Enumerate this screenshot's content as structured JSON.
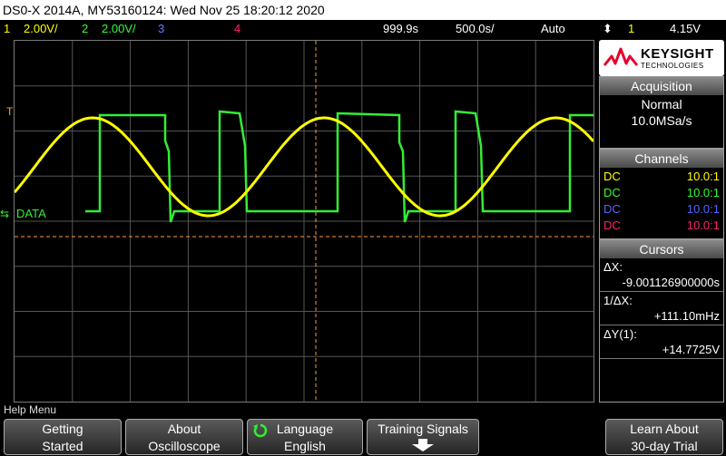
{
  "title_bar": {
    "text": "DS0-X 2014A, MY53160124: Wed Nov 25 18:20:12 2020"
  },
  "status_bar": {
    "ch1_num": "1",
    "ch1_scale": "2.00V/",
    "ch2_num": "2",
    "ch2_scale": "2.00V/",
    "ch3_num": "3",
    "ch4_num": "4",
    "delay": "999.9s",
    "timebase": "500.0s/",
    "trigger_mode": "Auto",
    "trigger_ch": "1",
    "trigger_level": "4.15V"
  },
  "screen": {
    "trigger_marker": "T",
    "data_label": "DATA",
    "waves": {
      "ch1": {
        "color": "#ffff00",
        "shape": "sine",
        "periods_per_screen": 2.5
      },
      "ch2": {
        "color": "#33ff33",
        "shape": "square"
      }
    }
  },
  "brand": {
    "name": "KEYSIGHT",
    "sub": "TECHNOLOGIES"
  },
  "acquisition": {
    "header": "Acquisition",
    "mode": "Normal",
    "rate": "10.0MSa/s"
  },
  "channels": {
    "header": "Channels",
    "rows": [
      {
        "coupling": "DC",
        "probe": "10.0:1",
        "color": "#ffff00"
      },
      {
        "coupling": "DC",
        "probe": "10.0:1",
        "color": "#33ff33"
      },
      {
        "coupling": "DC",
        "probe": "10.0:1",
        "color": "#5566ff"
      },
      {
        "coupling": "DC",
        "probe": "10.0:1",
        "color": "#ff2266"
      }
    ]
  },
  "cursors": {
    "header": "Cursors",
    "dx_label": "ΔX:",
    "dx_value": "-9.001126900000s",
    "inv_dx_label": "1/ΔX:",
    "inv_dx_value": "+111.10mHz",
    "dy_label": "ΔY(1):",
    "dy_value": "+14.7725V"
  },
  "help_bar": {
    "text": "Help Menu"
  },
  "softkeys": [
    {
      "line1": "Getting",
      "line2": "Started"
    },
    {
      "line1": "About",
      "line2": "Oscilloscope"
    },
    {
      "line1": "Language",
      "line2": "English"
    },
    {
      "line1": "Training Signals",
      "line2": ""
    },
    {
      "line1": "Learn About",
      "line2": "30-day Trial"
    }
  ]
}
